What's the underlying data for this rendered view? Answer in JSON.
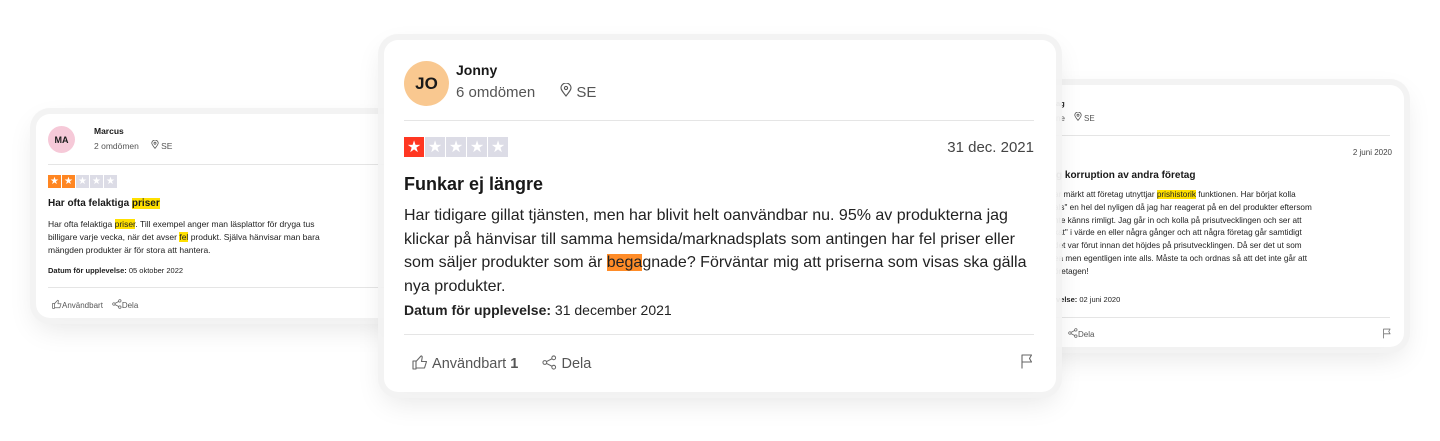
{
  "colors": {
    "star_active": "#ff3722",
    "star_active_small": "#ff8622",
    "star_inactive": "#dcdce6",
    "highlight_yellow": "#ffe000",
    "highlight_orange": "#ff8c28"
  },
  "main_review": {
    "avatar_initials": "JO",
    "name": "Jonny",
    "review_count": "6 omdömen",
    "country": "SE",
    "rating": 1,
    "date": "31 dec. 2021",
    "title": "Funkar ej längre",
    "body_part1": "Har tidigare gillat tjänsten, men har blivit helt oanvändbar nu. 95% av produkterna jag klickar på hänvisar till samma hemsida/marknadsplats som antingen har fel priser eller som säljer produkter som är ",
    "body_highlight": "bega",
    "body_part2": "gnade? Förväntar mig att priserna som visas ska gälla nya produkter.",
    "experience_label": "Datum för upplevelse:",
    "experience_date": "31 december 2021",
    "useful_label": "Användbart",
    "useful_count": "1",
    "share_label": "Dela"
  },
  "left_review": {
    "avatar_initials": "MA",
    "name": "Marcus",
    "review_count": "2 omdömen",
    "country": "SE",
    "rating": 2,
    "title_plain": "Har ofta felaktiga ",
    "title_highlight": "priser",
    "line1_a": "Har ofta felaktiga ",
    "line1_hl": "priser",
    "line1_b": ". Till exempel anger man läsplattor för dryga tus",
    "line2_a": "billigare varje vecka, när det avser ",
    "line2_hl": "fel",
    "line2_b": " produkt. Själva hänvisar man bara",
    "line3": "mängden produkter är för stora att hantera.",
    "experience_label": "Datum för upplevelse:",
    "experience_date": "05 oktober 2022",
    "useful_label": "Användbart",
    "share_label": "Dela"
  },
  "right_review": {
    "name_fragment": "ag",
    "count_fragment": "ne",
    "country": "SE",
    "date": "2 juni 2020",
    "title": "g korruption av andra företag",
    "line1_a": "ar märkt att företag utnyttjar ",
    "line1_hl": "prishistorik",
    "line1_b": " funktionen. Har börjat kolla",
    "line2": "als\" en hel del nyligen då jag har reagerat på en del produkter eftersom",
    "line3": "nte känns rimligt. Jag går in och kolla på prisutvecklingen och ser att",
    "line4": "kat\" i värde en eller några gånger och att några företag går samtidigt",
    "line5": "det var förut innan det höjdes på prisutvecklingen. Då ser det ut som",
    "line6": "ea men egentligen inte alls. Måste ta och ordnas så att det inte går att",
    "line7": "öretagen!",
    "experience_label": "velse:",
    "experience_date": "02 juni 2020",
    "share_label": "Dela"
  }
}
